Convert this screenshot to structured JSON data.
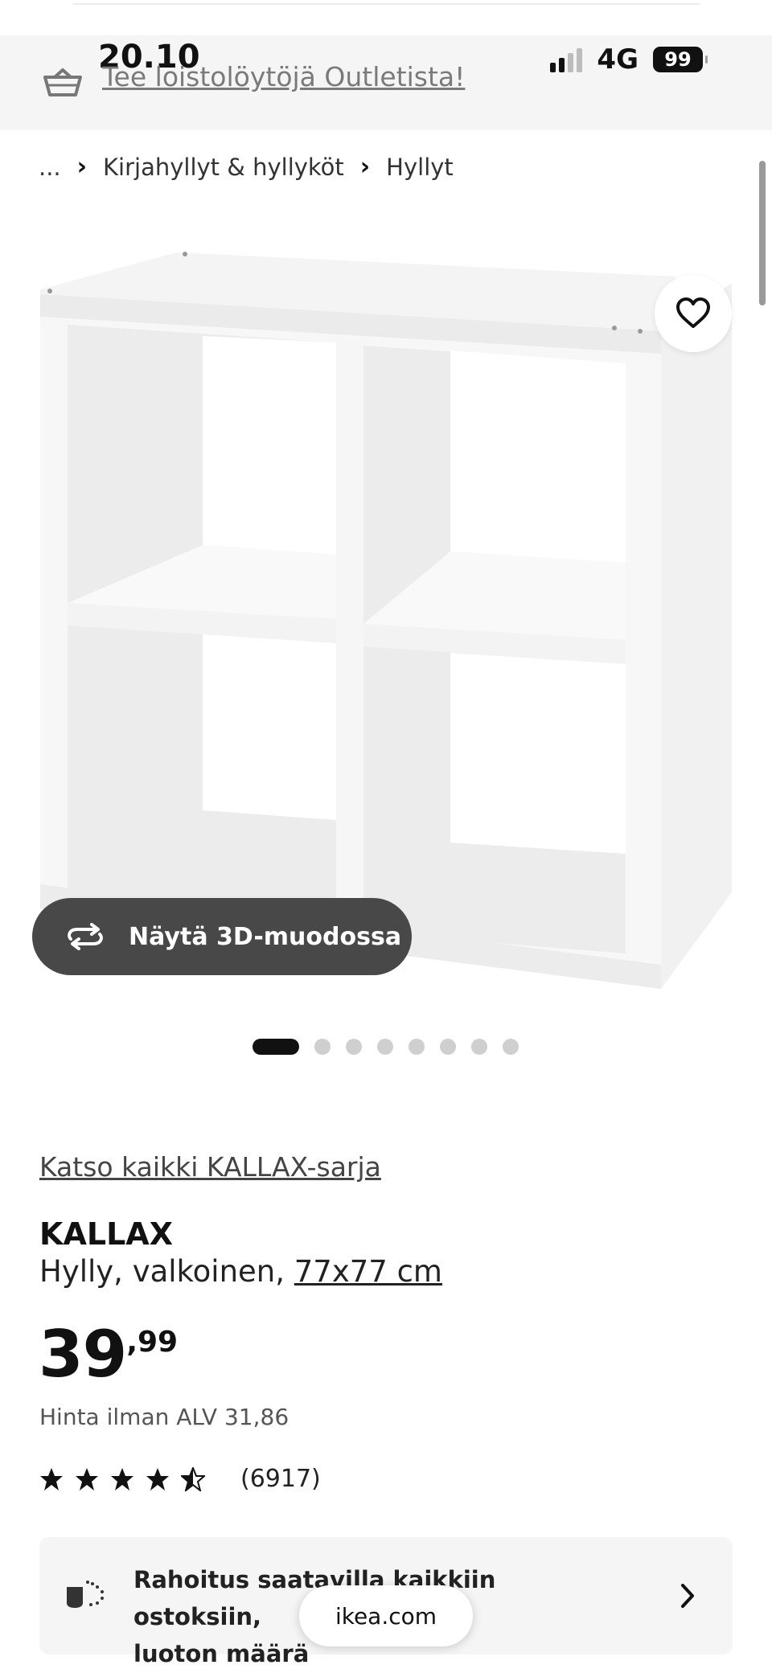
{
  "status_bar": {
    "time": "20.10",
    "network": "4G",
    "battery": "99"
  },
  "banner": {
    "promo_text": "Tee loistolöytöjä Outletista!"
  },
  "breadcrumb": {
    "ellipsis": "...",
    "separator": "›",
    "items": [
      "Kirjahyllyt & hyllyköt",
      "Hyllyt"
    ]
  },
  "gallery": {
    "view_3d_label": "Näytä 3D-muodossa",
    "image_count": 8,
    "active_index": 0
  },
  "product": {
    "series_link": "Katso kaikki KALLAX-sarja",
    "name": "KALLAX",
    "description": "Hylly, valkoinen, ",
    "size": "77x77 cm",
    "price_integer": "39",
    "price_decimal": ",99",
    "vat_line": "Hinta ilman ALV 31,86",
    "rating_stars": 4.5,
    "review_count": "(6917)"
  },
  "financing": {
    "line1": "Rahoitus saatavilla kaikkiin ostoksiin,",
    "line2": "luoton määrä"
  },
  "browser": {
    "url": "ikea.com"
  },
  "colors": {
    "banner_bg": "#f5f5f5",
    "dark_pill": "#484848",
    "card_bg": "#f5f5f5",
    "text": "#111111"
  }
}
